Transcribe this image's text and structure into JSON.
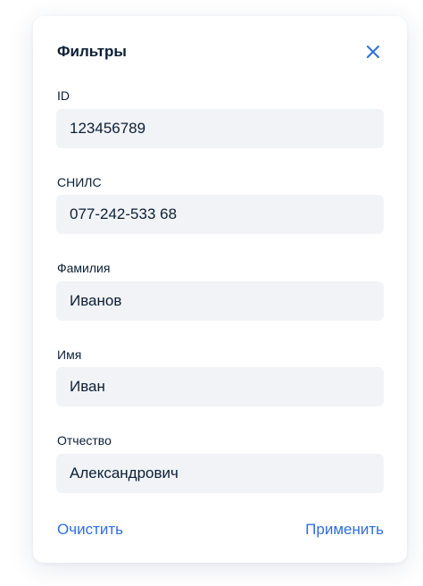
{
  "panel": {
    "title": "Фильтры",
    "close_icon": "close-icon",
    "accent_color": "#2f6fdc"
  },
  "fields": {
    "id": {
      "label": "ID",
      "value": "123456789"
    },
    "snils": {
      "label": "СНИЛС",
      "value": "077-242-533 68"
    },
    "last_name": {
      "label": "Фамилия",
      "value": "Иванов"
    },
    "first_name": {
      "label": "Имя",
      "value": "Иван"
    },
    "patronymic": {
      "label": "Отчество",
      "value": "Александрович"
    }
  },
  "actions": {
    "clear_label": "Очистить",
    "apply_label": "Применить"
  }
}
